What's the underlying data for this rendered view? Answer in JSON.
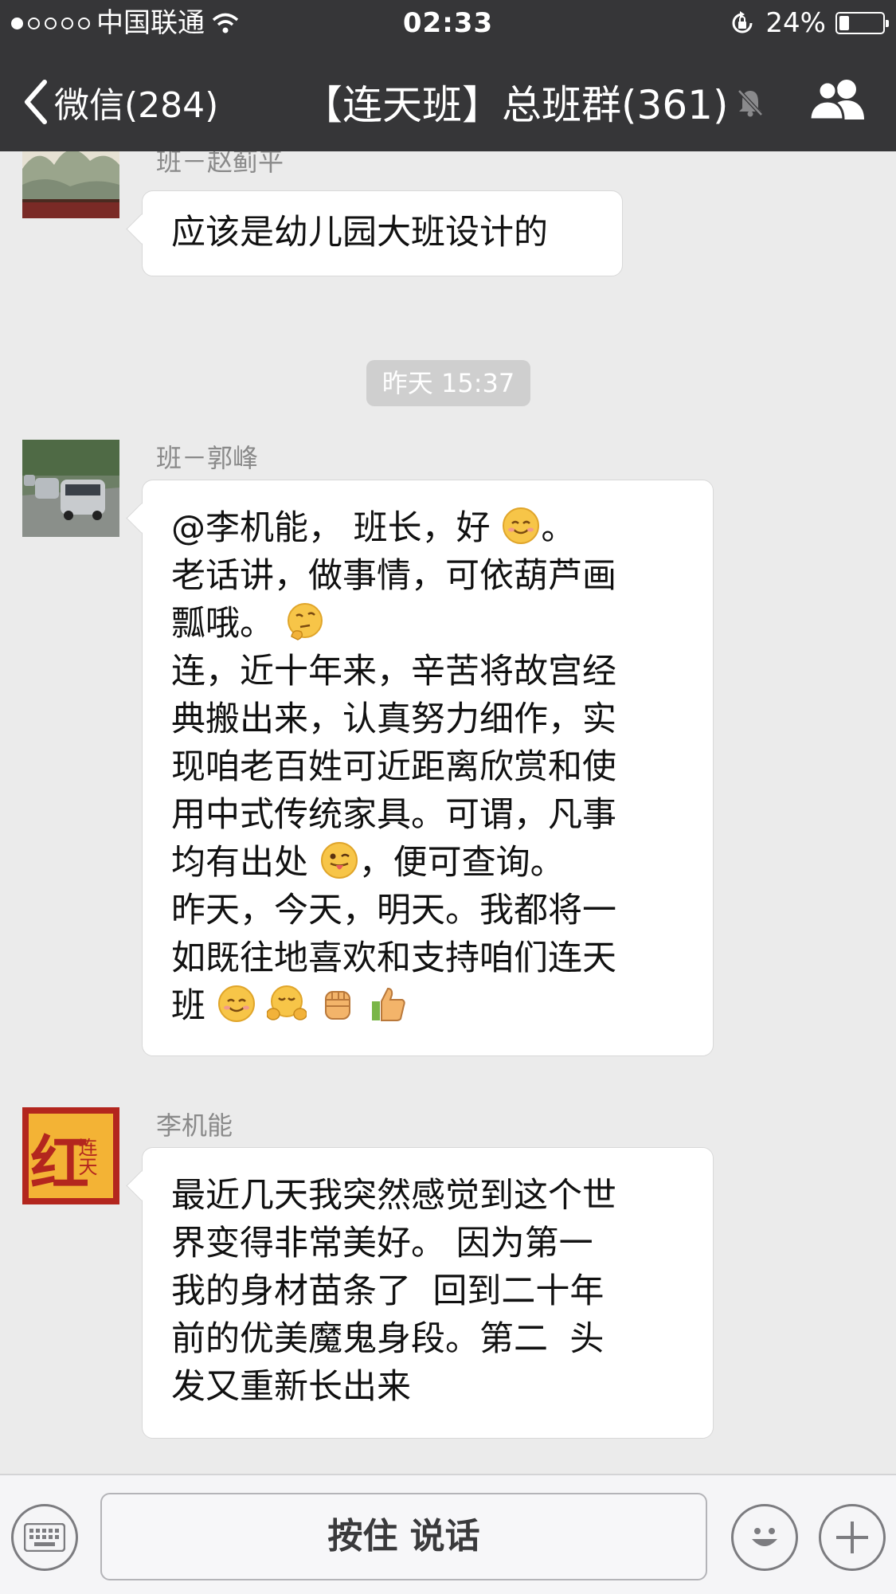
{
  "status_bar": {
    "carrier": "中国联通",
    "time": "02:33",
    "battery_percent": "24%",
    "battery_level": 0.24,
    "signal_dots_filled": 1
  },
  "nav": {
    "back_label": "微信(284)",
    "title": "【连天班】总班群(361)",
    "muted_icon": "bell-mute-icon",
    "people_icon": "group-members-icon"
  },
  "messages": [
    {
      "sender": "班－赵蓟平",
      "lines": [
        "应该是幼儿园大班设计的"
      ]
    },
    {
      "timestamp": "昨天 15:37"
    },
    {
      "sender": "班－郭峰",
      "lines": [
        "@李机能， 班长，好",
        "。",
        "老话讲，做事情，可依葫芦画",
        "瓢哦。",
        "连，近十年来，辛苦将故宫经",
        "典搬出来，认真努力细作，实",
        "现咱老百姓可近距离欣赏和使",
        "用中式传统家具。可谓，凡事",
        "均有出处",
        "，便可查询。",
        "昨天，今天，明天。我都将一",
        "如既往地喜欢和支持咱们连天",
        "班"
      ],
      "emojis": [
        "smile-emoji",
        "thinking-emoji",
        "wink-tongue-emoji",
        "smile-emoji",
        "hug-emoji",
        "fist-emoji",
        "thumbs-up-emoji"
      ]
    },
    {
      "sender": "李机能",
      "avatar_text": "红",
      "avatar_text2": "连天",
      "lines": [
        "最近几天我突然感觉到这个世",
        "界变得非常美好。 因为第一",
        "我的身材苗条了  回到二十年",
        "前的优美魔鬼身段。第二  头",
        "发又重新长出来"
      ]
    }
  ],
  "input_bar": {
    "voice_label": "按住 说话",
    "keyboard_icon": "keyboard-icon",
    "emoji_icon": "emoji-face-icon",
    "plus_icon": "plus-icon"
  },
  "colors": {
    "bar_bg": "#363638",
    "chat_bg": "#ebebeb",
    "bubble_bg": "#ffffff",
    "timestamp_chip": "#cfcfcf"
  }
}
